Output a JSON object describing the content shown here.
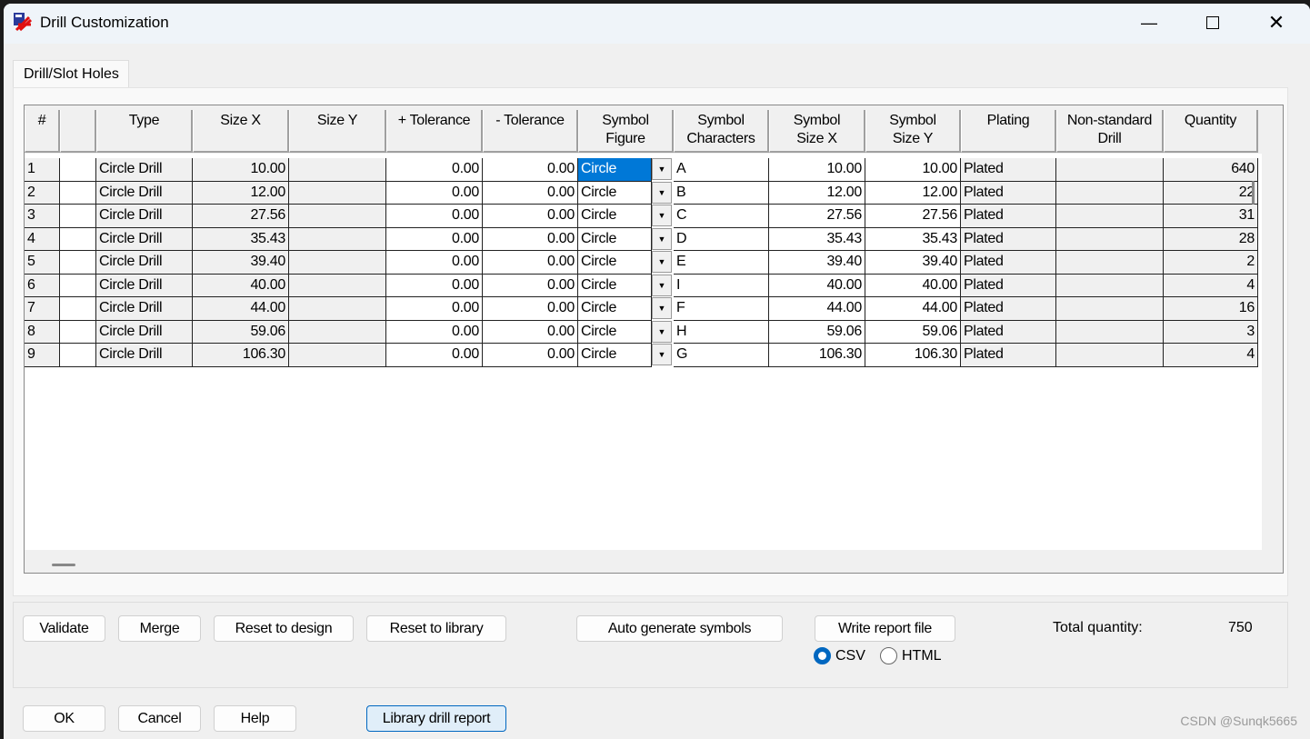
{
  "window": {
    "title": "Drill Customization",
    "controls": [
      "minimize",
      "maximize",
      "close"
    ]
  },
  "tabs": [
    {
      "label": "Drill/Slot Holes",
      "active": true
    }
  ],
  "table": {
    "columns": [
      "#",
      "",
      "Type",
      "Size X",
      "Size Y",
      "+ Tolerance",
      "- Tolerance",
      "Symbol\nFigure",
      "Symbol\nCharacters",
      "Symbol\nSize X",
      "Symbol\nSize Y",
      "Plating",
      "Non-standard\nDrill",
      "Quantity"
    ],
    "rows": [
      [
        "1",
        "",
        "Circle Drill",
        "10.00",
        "",
        "0.00",
        "0.00",
        "Circle",
        "A",
        "10.00",
        "10.00",
        "Plated",
        "",
        "640"
      ],
      [
        "2",
        "",
        "Circle Drill",
        "12.00",
        "",
        "0.00",
        "0.00",
        "Circle",
        "B",
        "12.00",
        "12.00",
        "Plated",
        "",
        "22"
      ],
      [
        "3",
        "",
        "Circle Drill",
        "27.56",
        "",
        "0.00",
        "0.00",
        "Circle",
        "C",
        "27.56",
        "27.56",
        "Plated",
        "",
        "31"
      ],
      [
        "4",
        "",
        "Circle Drill",
        "35.43",
        "",
        "0.00",
        "0.00",
        "Circle",
        "D",
        "35.43",
        "35.43",
        "Plated",
        "",
        "28"
      ],
      [
        "5",
        "",
        "Circle Drill",
        "39.40",
        "",
        "0.00",
        "0.00",
        "Circle",
        "E",
        "39.40",
        "39.40",
        "Plated",
        "",
        "2"
      ],
      [
        "6",
        "",
        "Circle Drill",
        "40.00",
        "",
        "0.00",
        "0.00",
        "Circle",
        "I",
        "40.00",
        "40.00",
        "Plated",
        "",
        "4"
      ],
      [
        "7",
        "",
        "Circle Drill",
        "44.00",
        "",
        "0.00",
        "0.00",
        "Circle",
        "F",
        "44.00",
        "44.00",
        "Plated",
        "",
        "16"
      ],
      [
        "8",
        "",
        "Circle Drill",
        "59.06",
        "",
        "0.00",
        "0.00",
        "Circle",
        "H",
        "59.06",
        "59.06",
        "Plated",
        "",
        "3"
      ],
      [
        "9",
        "",
        "Circle Drill",
        "106.30",
        "",
        "0.00",
        "0.00",
        "Circle",
        "G",
        "106.30",
        "106.30",
        "Plated",
        "",
        "4"
      ]
    ],
    "selected_cell": {
      "row": 1,
      "column": "Symbol Figure"
    }
  },
  "buttons": {
    "validate": "Validate",
    "merge": "Merge",
    "reset_design": "Reset to design",
    "reset_library": "Reset to library",
    "auto_generate": "Auto generate symbols",
    "write_report": "Write report file",
    "ok": "OK",
    "cancel": "Cancel",
    "help": "Help",
    "library_report": "Library drill report"
  },
  "report_format": {
    "options": [
      "CSV",
      "HTML"
    ],
    "selected": "CSV"
  },
  "total": {
    "label": "Total quantity:",
    "value": "750"
  },
  "watermark": "CSDN @Sunqk5665",
  "colors": {
    "selection": "#0078d7",
    "accent": "#0067c0"
  }
}
